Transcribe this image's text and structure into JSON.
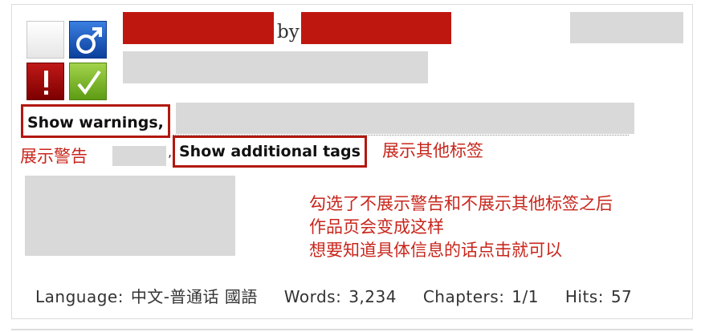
{
  "work": {
    "by_label": "by"
  },
  "rating_icons": [
    {
      "name": "blank",
      "symbol": ""
    },
    {
      "name": "male",
      "symbol": "♂"
    },
    {
      "name": "warning",
      "symbol": "!"
    },
    {
      "name": "complete",
      "symbol": "✓"
    }
  ],
  "buttons": {
    "show_warnings": "Show warnings,",
    "show_tags": "Show additional tags"
  },
  "separator_comma": ",",
  "annotations": {
    "warn_label": "展示警告",
    "tags_label": "展示其他标签",
    "note_lines": [
      "勾选了不展示警告和不展示其他标签之后",
      "作品页会变成这样",
      "想要知道具体信息的话点击就可以"
    ]
  },
  "stats": {
    "language_label": "Language:",
    "language_value": "中文-普通话 國語",
    "words_label": "Words:",
    "words_value": "3,234",
    "chapters_label": "Chapters:",
    "chapters_value": "1/1",
    "hits_label": "Hits:",
    "hits_value": "57"
  },
  "colors": {
    "redaction_red": "#be1710",
    "redaction_gray": "#d9d9d9",
    "annotation_red": "#c8261c",
    "button_border": "#b2180f"
  }
}
